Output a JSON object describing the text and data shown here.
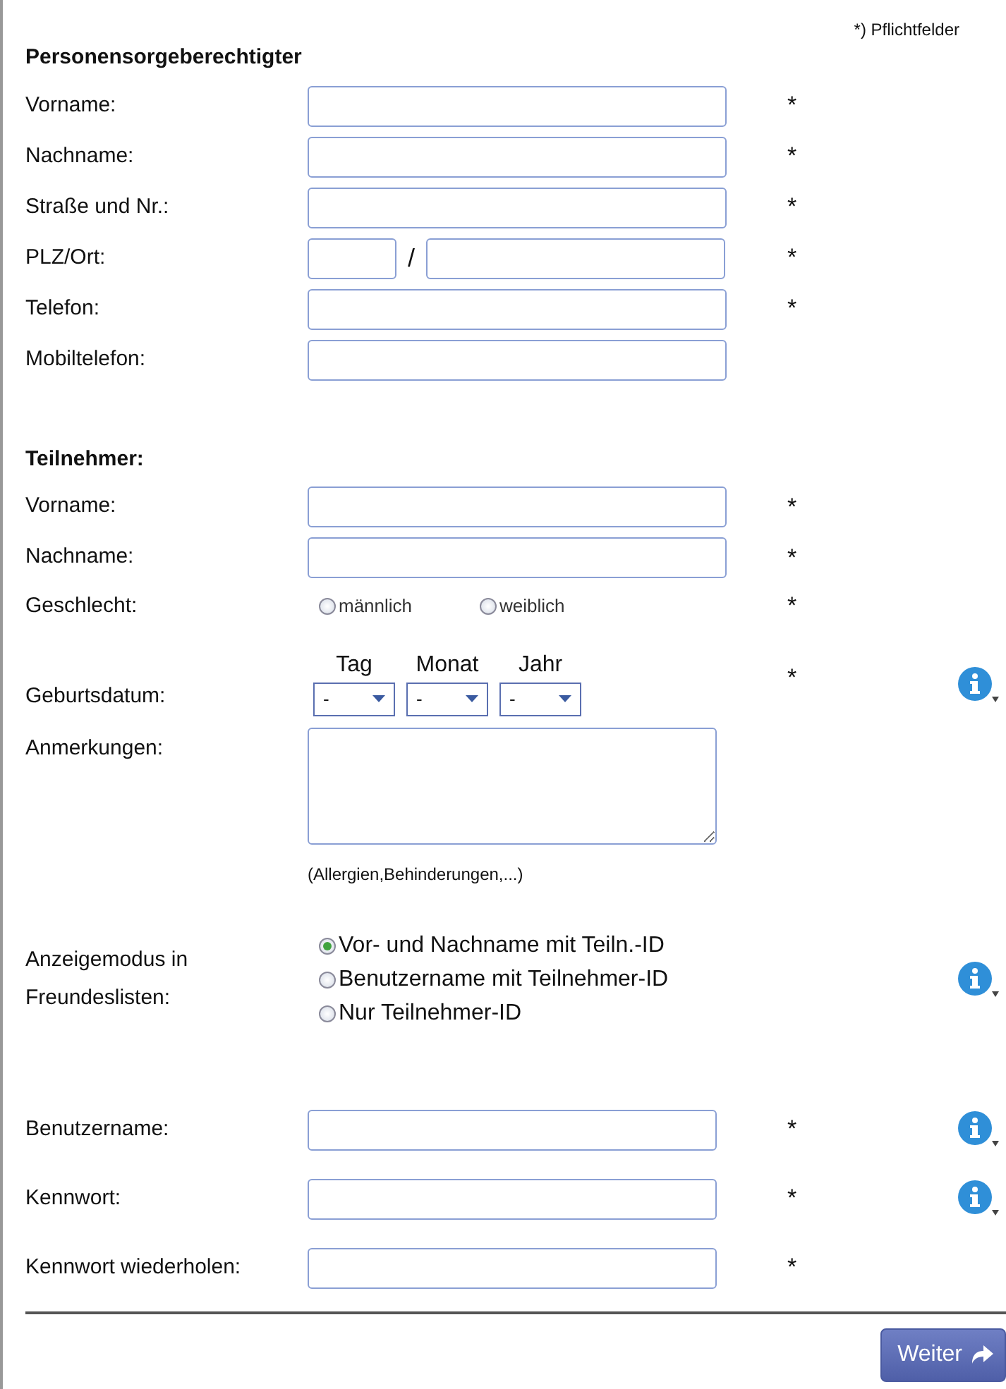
{
  "note": "*) Pflichtfelder",
  "sections": [
    {
      "title": "Personensorgeberechtigter",
      "rows": [
        {
          "kind": "text",
          "label": "Vorname:",
          "mark": "*"
        },
        {
          "kind": "text",
          "label": "Nachname:",
          "mark": "*"
        },
        {
          "kind": "text",
          "label": "Straße und Nr.:",
          "mark": "*"
        },
        {
          "kind": "plz",
          "label": "PLZ/Ort:",
          "separator": "/",
          "mark": "*"
        },
        {
          "kind": "text",
          "label": "Telefon:",
          "mark": "*"
        },
        {
          "kind": "text",
          "label": "Mobiltelefon:"
        }
      ]
    },
    {
      "title": "Teilnehmer:",
      "rows": [
        {
          "kind": "text",
          "label": "Vorname:",
          "mark": "*"
        },
        {
          "kind": "text",
          "label": "Nachname:",
          "mark": "*"
        },
        {
          "kind": "radio-inline",
          "label": "Geschlecht:",
          "mark": "*",
          "options": [
            {
              "label": "männlich",
              "selected": false
            },
            {
              "label": "weiblich",
              "selected": false
            }
          ]
        },
        {
          "kind": "date",
          "label": "Geburtsdatum:",
          "mark": "*",
          "info": true,
          "parts": [
            {
              "heading": "Tag",
              "value": "-"
            },
            {
              "heading": "Monat",
              "value": "-"
            },
            {
              "heading": "Jahr",
              "value": "-"
            }
          ]
        },
        {
          "kind": "textarea",
          "label": "Anmerkungen:",
          "hint": "(Allergien,Behinderungen,...)"
        },
        {
          "kind": "radio-stack",
          "label": "Anzeigemodus in Freundeslisten:",
          "info": true,
          "options": [
            {
              "label": "Vor- und Nachname mit Teiln.-ID",
              "selected": true
            },
            {
              "label": "Benutzername mit Teilnehmer-ID",
              "selected": false
            },
            {
              "label": "Nur Teilnehmer-ID",
              "selected": false
            }
          ]
        },
        {
          "kind": "text",
          "label": "Benutzername:",
          "mark": "*",
          "info": true
        },
        {
          "kind": "password",
          "label": "Kennwort:",
          "mark": "*",
          "info": true
        },
        {
          "kind": "password",
          "label": "Kennwort wiederholen:",
          "mark": "*",
          "info": false
        }
      ]
    }
  ],
  "button": {
    "label": "Weiter"
  }
}
